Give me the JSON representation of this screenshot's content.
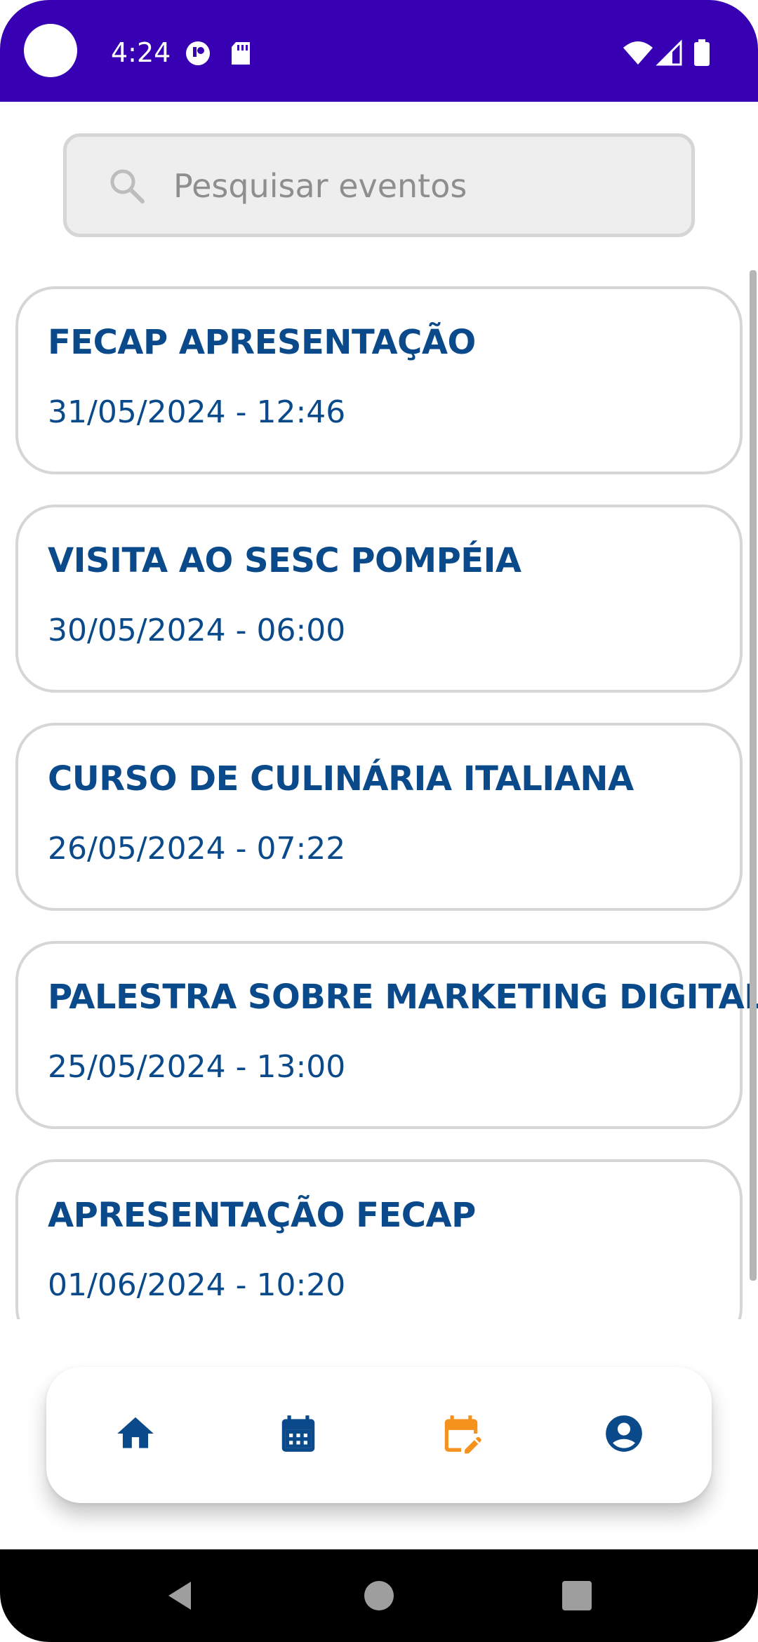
{
  "status_bar": {
    "time": "4:24",
    "background_color": "#3700b3",
    "icons": [
      "notification-icon",
      "sd-card-icon",
      "wifi-icon",
      "signal-icon",
      "battery-icon"
    ]
  },
  "search": {
    "placeholder": "Pesquisar eventos",
    "value": ""
  },
  "events": [
    {
      "title": "FECAP APRESENTAÇÃO",
      "datetime": "31/05/2024 - 12:46"
    },
    {
      "title": "VISITA AO SESC POMPÉIA",
      "datetime": "30/05/2024 - 06:00"
    },
    {
      "title": "CURSO DE CULINÁRIA ITALIANA",
      "datetime": "26/05/2024 - 07:22"
    },
    {
      "title": "PALESTRA SOBRE MARKETING DIGITAL",
      "datetime": "25/05/2024 - 13:00"
    },
    {
      "title": "APRESENTAÇÃO FECAP",
      "datetime": "01/06/2024 - 10:20"
    }
  ],
  "bottom_nav": {
    "items": [
      {
        "icon": "home-icon",
        "active": false
      },
      {
        "icon": "calendar-icon",
        "active": false
      },
      {
        "icon": "calendar-edit-icon",
        "active": true
      },
      {
        "icon": "account-circle-icon",
        "active": false
      }
    ],
    "active_color": "#f5921e",
    "inactive_color": "#0a4a8a"
  },
  "system_nav": {
    "buttons": [
      "back-icon",
      "home-circle-icon",
      "recents-icon"
    ]
  },
  "colors": {
    "primary_text": "#0a4a8a",
    "card_border": "#d6d6d6",
    "search_bg": "#eeeeee"
  }
}
